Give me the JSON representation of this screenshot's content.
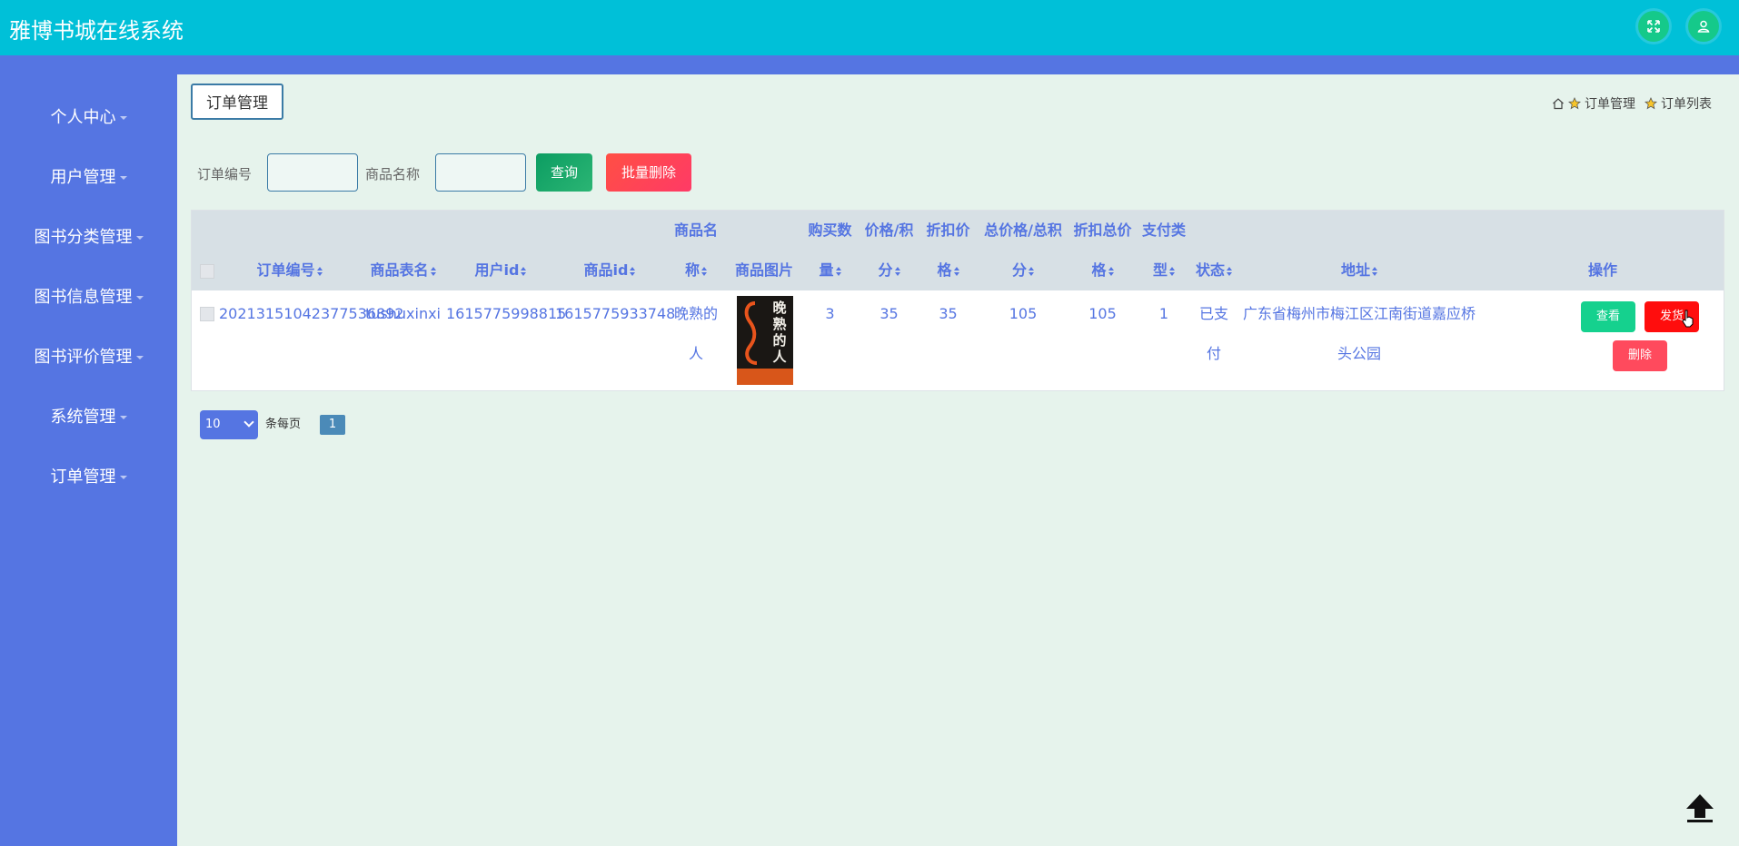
{
  "app": {
    "title": "雅博书城在线系统"
  },
  "header": {
    "icons": [
      "fullscreen-icon",
      "user-icon"
    ]
  },
  "sidebar": {
    "items": [
      {
        "label": "个人中心"
      },
      {
        "label": "用户管理"
      },
      {
        "label": "图书分类管理"
      },
      {
        "label": "图书信息管理"
      },
      {
        "label": "图书评价管理"
      },
      {
        "label": "系统管理"
      },
      {
        "label": "订单管理"
      }
    ]
  },
  "page": {
    "tag": "订单管理"
  },
  "breadcrumb": {
    "items": [
      "订单管理",
      "订单列表"
    ]
  },
  "filters": {
    "order_no_label": "订单编号",
    "order_no_value": "",
    "product_name_label": "商品名称",
    "product_name_value": "",
    "query_button": "查询",
    "batch_delete_button": "批量删除"
  },
  "table": {
    "columns": [
      {
        "l1": "",
        "l2": "订单编号"
      },
      {
        "l1": "",
        "l2": "商品表名"
      },
      {
        "l1": "",
        "l2": "用户id"
      },
      {
        "l1": "",
        "l2": "商品id"
      },
      {
        "l1": "商品名",
        "l2": "称"
      },
      {
        "l1": "",
        "l2": "商品图片"
      },
      {
        "l1": "购买数",
        "l2": "量"
      },
      {
        "l1": "价格/积",
        "l2": "分"
      },
      {
        "l1": "折扣价",
        "l2": "格"
      },
      {
        "l1": "总价格/总积",
        "l2": "分"
      },
      {
        "l1": "折扣总价",
        "l2": "格"
      },
      {
        "l1": "支付类",
        "l2": "型"
      },
      {
        "l1": "",
        "l2": "状态"
      },
      {
        "l1": "",
        "l2": "地址"
      },
      {
        "l1": "",
        "l2": "操作"
      }
    ],
    "rows": [
      {
        "order_no": "20213151042377536892",
        "table_name": "tushuxinxi",
        "user_id": "1615775998815",
        "product_id": "1615775933748",
        "product_name_l1": "晚熟的",
        "product_name_l2": "人",
        "image_text": "晚熟的人",
        "quantity": "3",
        "price": "35",
        "discount_price": "35",
        "total_price": "105",
        "discount_total": "105",
        "pay_type": "1",
        "status_l1": "已支",
        "status_l2": "付",
        "address_l1": "广东省梅州市梅江区江南街道嘉应桥",
        "address_l2": "头公园",
        "actions": {
          "view": "查看",
          "ship": "发货",
          "delete": "删除"
        }
      }
    ]
  },
  "pagination": {
    "page_size": "10",
    "per_page_label": "条每页",
    "current_page": "1"
  },
  "colors": {
    "topbar": "#00c0d8",
    "sidebar": "#5575e2",
    "accent": "#5575e2",
    "background": "#e6f3ec"
  }
}
